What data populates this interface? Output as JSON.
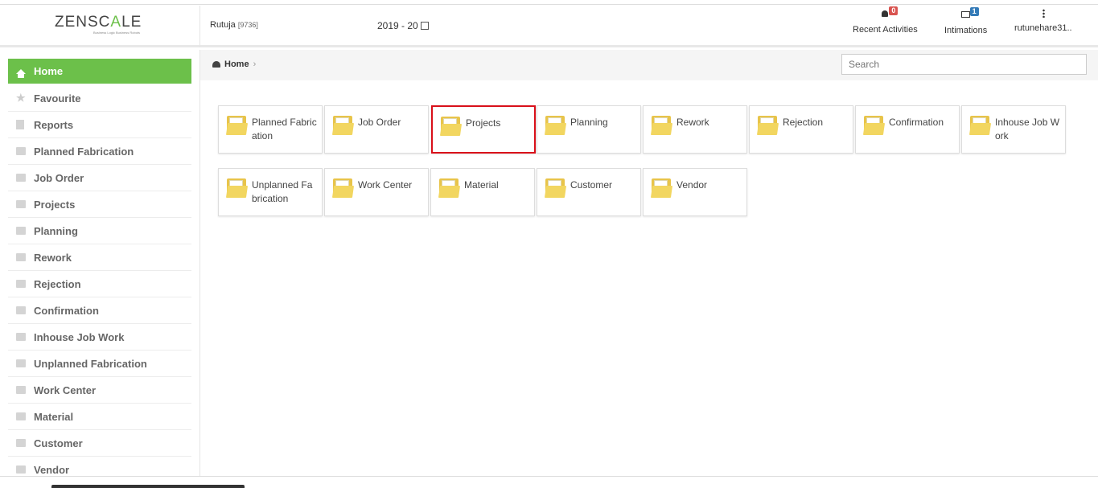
{
  "header": {
    "logo_text_1": "ZENSC",
    "logo_text_2": "A",
    "logo_text_3": "LE",
    "tagline": "Business Logic Business Robots",
    "user_name": "Rutuja",
    "user_id": "[9736]",
    "year": "2019 - 20",
    "recent_activities": {
      "label": "Recent Activities",
      "count": "0"
    },
    "intimations": {
      "label": "Intimations",
      "count": "1"
    },
    "account": {
      "label": "rutunehare31.."
    }
  },
  "sidebar": {
    "items": [
      {
        "label": "Home",
        "icon": "home-icon",
        "active": true
      },
      {
        "label": "Favourite",
        "icon": "star-icon"
      },
      {
        "label": "Reports",
        "icon": "document-icon"
      },
      {
        "label": "Planned Fabrication",
        "icon": "folder-icon"
      },
      {
        "label": "Job Order",
        "icon": "folder-icon"
      },
      {
        "label": "Projects",
        "icon": "folder-icon"
      },
      {
        "label": "Planning",
        "icon": "folder-icon"
      },
      {
        "label": "Rework",
        "icon": "folder-icon"
      },
      {
        "label": "Rejection",
        "icon": "folder-icon"
      },
      {
        "label": "Confirmation",
        "icon": "folder-icon"
      },
      {
        "label": "Inhouse Job Work",
        "icon": "folder-icon"
      },
      {
        "label": "Unplanned Fabrication",
        "icon": "folder-icon"
      },
      {
        "label": "Work Center",
        "icon": "folder-icon"
      },
      {
        "label": "Material",
        "icon": "folder-icon"
      },
      {
        "label": "Customer",
        "icon": "folder-icon"
      },
      {
        "label": "Vendor",
        "icon": "folder-icon"
      }
    ]
  },
  "breadcrumb": {
    "home": "Home",
    "separator": "›"
  },
  "search": {
    "placeholder": "Search"
  },
  "tiles": [
    {
      "label": "Planned Fabrication"
    },
    {
      "label": "Job Order"
    },
    {
      "label": "Projects",
      "selected": true
    },
    {
      "label": "Planning"
    },
    {
      "label": "Rework"
    },
    {
      "label": "Rejection"
    },
    {
      "label": "Confirmation"
    },
    {
      "label": "Inhouse Job Work"
    },
    {
      "label": "Unplanned Fabrication"
    },
    {
      "label": "Work Center"
    },
    {
      "label": "Material"
    },
    {
      "label": "Customer"
    },
    {
      "label": "Vendor"
    }
  ],
  "colors": {
    "accent": "#6cc04a",
    "selection": "#d9101a",
    "badge_red": "#d9534f",
    "badge_blue": "#337ab7",
    "folder": "#f2d660"
  }
}
